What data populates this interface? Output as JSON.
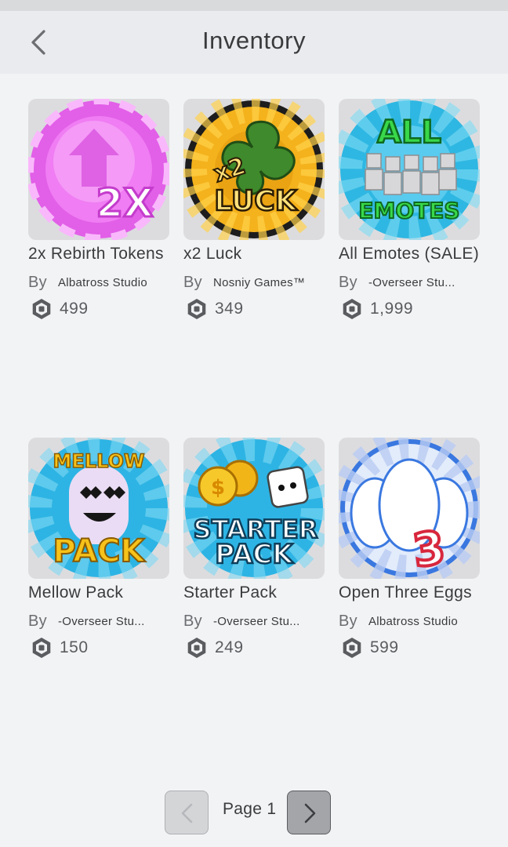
{
  "header": {
    "title": "Inventory"
  },
  "items": [
    {
      "name": "2x Rebirth Tokens",
      "by_label": "By",
      "creator": "Albatross Studio",
      "price": "499",
      "icon": "rebirth-token-icon"
    },
    {
      "name": "x2 Luck",
      "by_label": "By",
      "creator": "Nosniy Games™",
      "price": "349",
      "icon": "luck-clover-icon"
    },
    {
      "name": "All Emotes (SALE)",
      "by_label": "By",
      "creator": "-Overseer Stu...",
      "price": "1,999",
      "icon": "all-emotes-icon"
    },
    {
      "name": "Mellow Pack",
      "by_label": "By",
      "creator": "-Overseer Stu...",
      "price": "150",
      "icon": "mellow-pack-icon"
    },
    {
      "name": "Starter Pack",
      "by_label": "By",
      "creator": "-Overseer Stu...",
      "price": "249",
      "icon": "starter-pack-icon"
    },
    {
      "name": "Open Three Eggs",
      "by_label": "By",
      "creator": "Albatross Studio",
      "price": "599",
      "icon": "three-eggs-icon"
    }
  ],
  "pager": {
    "label": "Page 1"
  },
  "colors": {
    "background": "#f2f3f5",
    "header": "#e9ebee",
    "text": "#393b3d"
  }
}
